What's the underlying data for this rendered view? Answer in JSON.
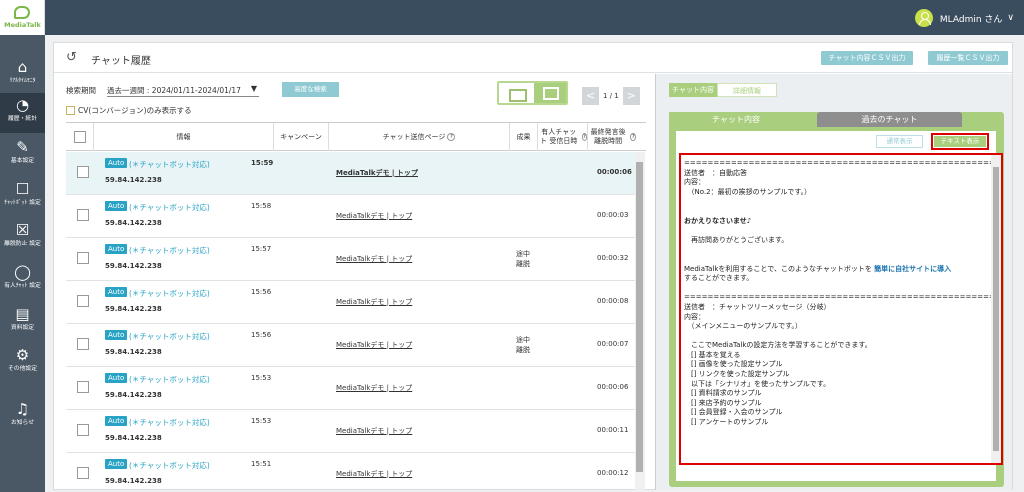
{
  "app": {
    "logo_text": "MediaTalk",
    "user_label": "MLAdmin さん",
    "user_caret": "∨"
  },
  "sidebar": [
    {
      "label": "ﾘｱﾙﾀｲﾑﾓﾆﾀ",
      "icon": "home-icon"
    },
    {
      "label": "履歴・統計",
      "icon": "pie-chart-icon"
    },
    {
      "label": "基本設定",
      "icon": "wrench-icon"
    },
    {
      "label": "ﾁｬｯﾄﾎﾞｯﾄ 設定",
      "icon": "robot-icon"
    },
    {
      "label": "離脱防止 設定",
      "icon": "close-box-icon"
    },
    {
      "label": "有人ﾁｬｯﾄ 設定",
      "icon": "chat-bubble-icon"
    },
    {
      "label": "資料設定",
      "icon": "document-icon"
    },
    {
      "label": "その他設定",
      "icon": "gears-icon"
    },
    {
      "label": "お知らせ",
      "icon": "bell-icon"
    }
  ],
  "header": {
    "title": "チャット履歴",
    "csv_chat": "チャット内容ＣＳＶ出力",
    "csv_history": "履歴一覧ＣＳＶ出力"
  },
  "filters": {
    "period_label": "検索期間",
    "period_value": "過去一週間 : 2024/01/11-2024/01/17",
    "advanced_search": "高度な検索",
    "cv_only": "CV(コンバージョン)のみ表示する"
  },
  "pager": {
    "text": "1 / 1",
    "prev": "<",
    "next": ">"
  },
  "table": {
    "columns": [
      "情報",
      "キャンペーン",
      "チャット送信ページ",
      "成果",
      "有人チャット 受信日時",
      "最終発言後 離脱時間"
    ],
    "rows": [
      {
        "badge": "Auto",
        "bot": "(＊チャットボット対応)",
        "ip": "59.84.142.238",
        "time": "15:59",
        "page": "MediaTalkデモ | トップ",
        "result": "",
        "dur": "00:00:06"
      },
      {
        "badge": "Auto",
        "bot": "(＊チャットボット対応)",
        "ip": "59.84.142.238",
        "time": "15:58",
        "page": "MediaTalkデモ | トップ",
        "result": "",
        "dur": "00:00:03"
      },
      {
        "badge": "Auto",
        "bot": "(＊チャットボット対応)",
        "ip": "59.84.142.238",
        "time": "15:57",
        "page": "MediaTalkデモ | トップ",
        "result": "途中\n離脱",
        "dur": "00:00:32"
      },
      {
        "badge": "Auto",
        "bot": "(＊チャットボット対応)",
        "ip": "59.84.142.238",
        "time": "15:56",
        "page": "MediaTalkデモ | トップ",
        "result": "",
        "dur": "00:00:08"
      },
      {
        "badge": "Auto",
        "bot": "(＊チャットボット対応)",
        "ip": "59.84.142.238",
        "time": "15:56",
        "page": "MediaTalkデモ | トップ",
        "result": "途中\n離脱",
        "dur": "00:00:07"
      },
      {
        "badge": "Auto",
        "bot": "(＊チャットボット対応)",
        "ip": "59.84.142.238",
        "time": "15:53",
        "page": "MediaTalkデモ | トップ",
        "result": "",
        "dur": "00:00:06"
      },
      {
        "badge": "Auto",
        "bot": "(＊チャットボット対応)",
        "ip": "59.84.142.238",
        "time": "15:53",
        "page": "MediaTalkデモ | トップ",
        "result": "",
        "dur": "00:00:11"
      },
      {
        "badge": "Auto",
        "bot": "(＊チャットボット対応)",
        "ip": "59.84.142.238",
        "time": "15:51",
        "page": "MediaTalkデモ | トップ",
        "result": "",
        "dur": "00:00:12"
      }
    ]
  },
  "detail": {
    "tabs": [
      "チャット内容",
      "詳細情報"
    ],
    "card_tabs": [
      "チャット内容",
      "過去のチャット"
    ],
    "btn_normal": "通常表示",
    "btn_text": "テキスト表示",
    "log": {
      "sep": "================================================================",
      "l1": "送信者　：自動応答",
      "l2": "内容：",
      "l3": "　（No.2：最初の挨拶のサンプルです。）",
      "l4": "おかえりなさいませ♪",
      "l5": "　再訪問ありがとうございます。",
      "l6a": "MediaTalkを利用することで、このようなチャットボットを ",
      "l6b": "簡単に自社サイトに導入",
      "l6c": "することができます。",
      "l7": "送信者　：チャットツリーメッセージ（分岐）",
      "l8": "内容：",
      "l9": "　（メインメニューのサンプルです。）",
      "l10": "　ここでMediaTalkの設定方法を学習することができます。",
      "l11": "　[] 基本を覚える",
      "l12": "　[] 画像を使った設定サンプル",
      "l13": "　[] リンクを使った設定サンプル",
      "l14": "　以下は「シナリオ」を使ったサンプルです。",
      "l15": "　[] 資料請求のサンプル",
      "l16": "　[] 来店予約のサンプル",
      "l17": "　[] 会員登録・入会のサンプル",
      "l18": "　[] アンケートのサンプル"
    }
  }
}
